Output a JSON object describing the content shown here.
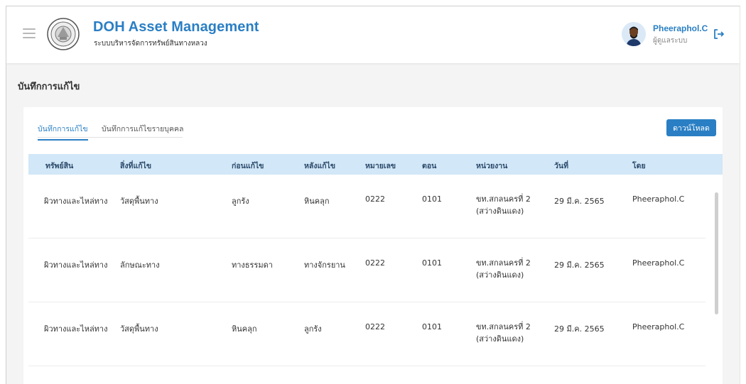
{
  "header": {
    "title": "DOH Asset Management",
    "subtitle": "ระบบบริหารจัดการทรัพย์สินทางหลวง",
    "user_name": "Pheeraphol.C",
    "user_role": "ผู้ดูแลระบบ"
  },
  "page": {
    "title": "บันทึกการแก้ไข"
  },
  "tabs": [
    {
      "label": "บันทึกการแก้ไข",
      "active": true
    },
    {
      "label": "บันทึกการแก้ไขรายบุคคล",
      "active": false
    }
  ],
  "actions": {
    "download_label": "ดาวน์โหลด"
  },
  "colors": {
    "accent": "#2a7fc4",
    "table_header_bg": "#d2e7f7"
  },
  "table": {
    "columns": [
      "ทรัพย์สิน",
      "สิ่งที่แก้ไข",
      "ก่อนแก้ไข",
      "หลังแก้ไข",
      "หมายเลข",
      "ตอน",
      "หน่วยงาน",
      "วันที่",
      "โดย"
    ],
    "rows": [
      {
        "asset": "ผิวทางและไหล่ทาง",
        "field": "วัสดุพื้นทาง",
        "before": "ลูกรัง",
        "after": "หินคลุก",
        "number": "0222",
        "section": "0101",
        "unit_line1": "ขท.สกลนครที่ 2",
        "unit_line2": "(สว่างดินแดง)",
        "date": "29 มี.ค. 2565",
        "by": "Pheeraphol.C"
      },
      {
        "asset": "ผิวทางและไหล่ทาง",
        "field": "ลักษณะทาง",
        "before": "ทางธรรมดา",
        "after": "ทางจักรยาน",
        "number": "0222",
        "section": "0101",
        "unit_line1": "ขท.สกลนครที่ 2",
        "unit_line2": "(สว่างดินแดง)",
        "date": "29 มี.ค. 2565",
        "by": "Pheeraphol.C"
      },
      {
        "asset": "ผิวทางและไหล่ทาง",
        "field": "วัสดุพื้นทาง",
        "before": "หินคลุก",
        "after": "ลูกรัง",
        "number": "0222",
        "section": "0101",
        "unit_line1": "ขท.สกลนครที่ 2",
        "unit_line2": "(สว่างดินแดง)",
        "date": "29 มี.ค. 2565",
        "by": "Pheeraphol.C"
      }
    ]
  }
}
